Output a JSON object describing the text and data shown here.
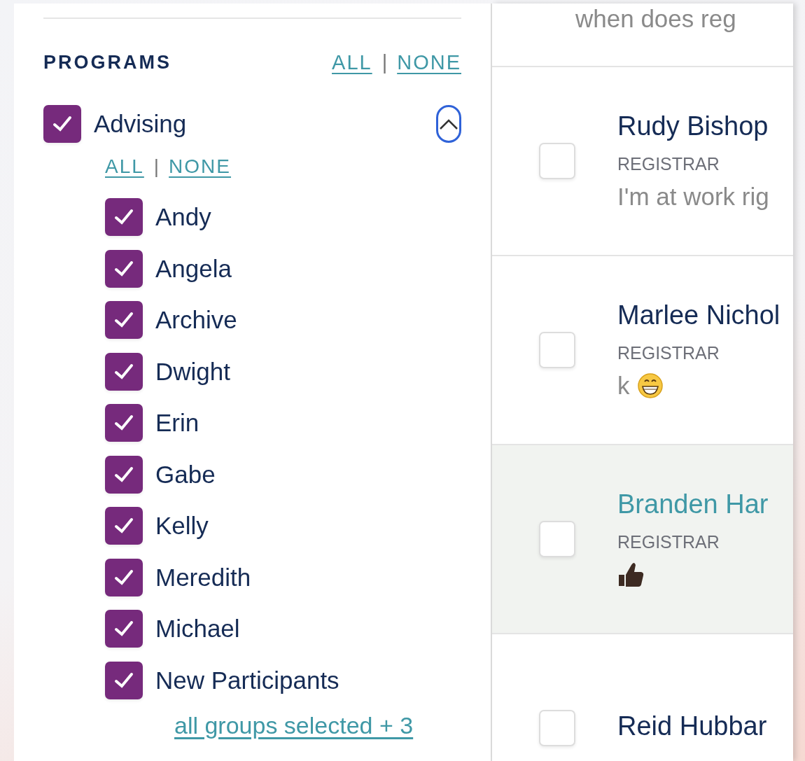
{
  "sidebar": {
    "section_title": "PROGRAMS",
    "section_links": [
      "ALL",
      "NONE"
    ],
    "separator": "|",
    "program": {
      "label": "Advising",
      "checked": true,
      "expanded": true,
      "links": [
        "ALL",
        "NONE"
      ],
      "separator": "|",
      "children": [
        {
          "label": "Andy",
          "checked": true
        },
        {
          "label": "Angela",
          "checked": true
        },
        {
          "label": "Archive",
          "checked": true
        },
        {
          "label": "Dwight",
          "checked": true
        },
        {
          "label": "Erin",
          "checked": true
        },
        {
          "label": "Gabe",
          "checked": true
        },
        {
          "label": "Kelly",
          "checked": true
        },
        {
          "label": "Meredith",
          "checked": true
        },
        {
          "label": "Michael",
          "checked": true
        },
        {
          "label": "New Participants",
          "checked": true
        }
      ],
      "summary_link": "all groups selected + 3"
    }
  },
  "conversations": [
    {
      "kind": "partial",
      "message": "when does reg",
      "selected": false
    },
    {
      "kind": "full",
      "name": "Rudy Bishop",
      "tag": "REGISTRAR",
      "message": "I'm at work rig",
      "selected": false,
      "checked": false
    },
    {
      "kind": "full",
      "name": "Marlee Nichol",
      "tag": "REGISTRAR",
      "message": "k",
      "emoji": {
        "kind": "grin"
      },
      "selected": false,
      "checked": false
    },
    {
      "kind": "full",
      "name": "Branden Har",
      "tag": "REGISTRAR",
      "emoji": {
        "kind": "thumbs-up"
      },
      "selected": true,
      "checked": false
    },
    {
      "kind": "full",
      "name": "Reid Hubbar",
      "selected": false,
      "checked": false
    }
  ]
}
